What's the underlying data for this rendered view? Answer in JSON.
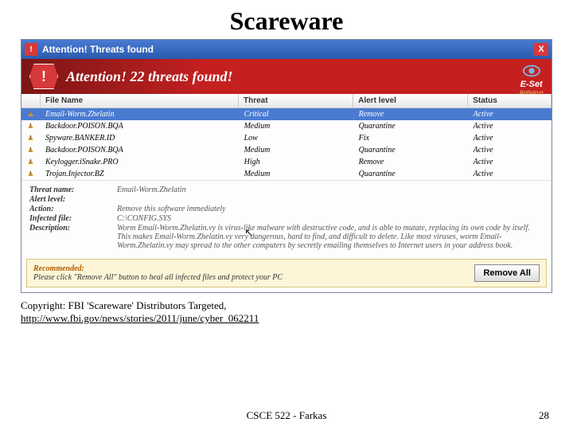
{
  "slide": {
    "title": "Scareware"
  },
  "titlebar": {
    "text": "Attention! Threats found",
    "close": "X"
  },
  "banner": {
    "text": "Attention! 22 threats found!",
    "brand_name_e": "E",
    "brand_name_rest": "-Set",
    "brand_sub": "Antivirus"
  },
  "headers": {
    "filename": "File Name",
    "threat": "Threat",
    "alert": "Alert level",
    "status": "Status"
  },
  "rows": [
    {
      "name": "Email-Worm.Zhelatin",
      "threat": "Critical",
      "alert": "Remove",
      "status": "Active",
      "selected": true
    },
    {
      "name": "Backdoor.POISON.BQA",
      "threat": "Medium",
      "alert": "Quarantine",
      "status": "Active"
    },
    {
      "name": "Spyware.BANKER.ID",
      "threat": "Low",
      "alert": "Fix",
      "status": "Active"
    },
    {
      "name": "Backdoor.POISON.BQA",
      "threat": "Medium",
      "alert": "Quarantine",
      "status": "Active"
    },
    {
      "name": "Keylogger.iSnake.PRO",
      "threat": "High",
      "alert": "Remove",
      "status": "Active"
    },
    {
      "name": "Trojan.Injector.BZ",
      "threat": "Medium",
      "alert": "Quarantine",
      "status": "Active"
    }
  ],
  "details": {
    "labels": {
      "name": "Threat name:",
      "alert": "Alert level:",
      "action": "Action:",
      "file": "Infected file:",
      "desc": "Description:"
    },
    "name": "Email-Worm.Zhelatin",
    "alert": "",
    "action": "Remove this software immediately",
    "file": "C:\\CONFIG.SYS",
    "desc": "Worm Email-Worm.Zhelatin.vy is virus-like malware with destructive code, and is able to mutate, replacing its own code by itself. This makes Email-Worm.Zhelatin.vy very dangerous, hard to find, and difficult to delete. Like most viruses, worm Email-Worm.Zhelatin.vy may spread to the other computers by secretly emailing themselves to Internet users in your address book."
  },
  "recommended": {
    "title": "Recommended:",
    "desc": "Please click \"Remove All\" button to heal all infected files and protect your PC",
    "button": "Remove All"
  },
  "copyright": {
    "text": "Copyright: FBI 'Scareware' Distributors Targeted,",
    "link": "http://www.fbi.gov/news/stories/2011/june/cyber_062211"
  },
  "footer": {
    "course": "CSCE 522 - Farkas",
    "page": "28"
  }
}
